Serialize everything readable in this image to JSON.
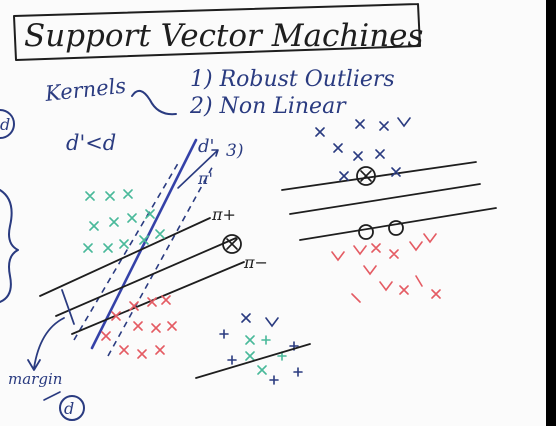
{
  "board": {
    "title": "Support Vector Machines",
    "kernels": "Kernels",
    "points": [
      "1) Robust Outliers",
      "2) Non Linear",
      "3)"
    ],
    "condition": "d'<d",
    "dprime": "d'",
    "pi_plus": "π+",
    "pi_minus": "π−",
    "pi_prime": "π'",
    "margin": "margin",
    "d_circled": "d",
    "left_circled": "d"
  },
  "colors": {
    "ink": "#2a3b80",
    "positive": "#49b99a",
    "negative": "#e45b63",
    "black": "#1e1e1e"
  }
}
